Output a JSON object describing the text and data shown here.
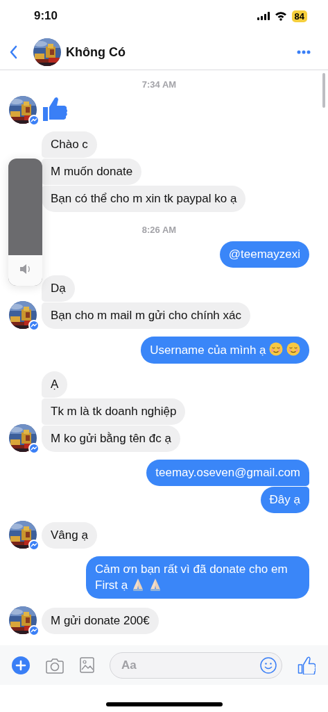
{
  "status_bar": {
    "time": "9:10",
    "battery": "84"
  },
  "header": {
    "title": "Không Có"
  },
  "conversation": [
    {
      "kind": "time",
      "text": "7:34 AM"
    },
    {
      "kind": "incoming",
      "avatar": true,
      "messages": [
        {
          "kind": "like"
        }
      ]
    },
    {
      "kind": "incoming",
      "avatar": false,
      "messages": [
        {
          "kind": "text",
          "text": "Chào c"
        },
        {
          "kind": "text",
          "text": "M muốn donate"
        },
        {
          "kind": "text",
          "text": "Bạn có thể cho m xin tk paypal ko ạ"
        }
      ]
    },
    {
      "kind": "time",
      "text": "8:26 AM"
    },
    {
      "kind": "outgoing",
      "messages": [
        {
          "kind": "text",
          "text": "@teemayzexi"
        }
      ]
    },
    {
      "kind": "incoming",
      "avatar": true,
      "messages": [
        {
          "kind": "text",
          "text": "Dạ"
        },
        {
          "kind": "text",
          "text": "Bạn cho m mail m gửi cho chính xác"
        }
      ]
    },
    {
      "kind": "outgoing",
      "messages": [
        {
          "kind": "text",
          "text": "Username của mình ạ",
          "emoji": [
            {
              "kind": "smiling-face"
            },
            {
              "kind": "smiling-face"
            }
          ]
        }
      ]
    },
    {
      "kind": "incoming",
      "avatar": true,
      "messages": [
        {
          "kind": "text",
          "text": "Ạ"
        },
        {
          "kind": "text",
          "text": "Tk m là tk doanh nghiệp"
        },
        {
          "kind": "text",
          "text": "M ko gửi bằng tên đc ạ"
        }
      ]
    },
    {
      "kind": "outgoing",
      "messages": [
        {
          "kind": "text",
          "text": "teemay.oseven@gmail.com"
        },
        {
          "kind": "text",
          "text": "Đây ạ"
        }
      ]
    },
    {
      "kind": "incoming",
      "avatar": true,
      "messages": [
        {
          "kind": "text",
          "text": "Vâng ạ"
        }
      ]
    },
    {
      "kind": "outgoing",
      "messages": [
        {
          "kind": "text",
          "text": "Cảm ơn bạn rất vì đã donate cho em First ạ",
          "emoji": [
            {
              "kind": "folded-hands"
            },
            {
              "kind": "folded-hands"
            }
          ]
        }
      ]
    },
    {
      "kind": "incoming",
      "avatar": true,
      "messages": [
        {
          "kind": "text",
          "text": "M gửi donate 200€"
        }
      ]
    }
  ],
  "volume_hud": {
    "level": 0.24
  },
  "composer": {
    "placeholder": "Aa"
  }
}
